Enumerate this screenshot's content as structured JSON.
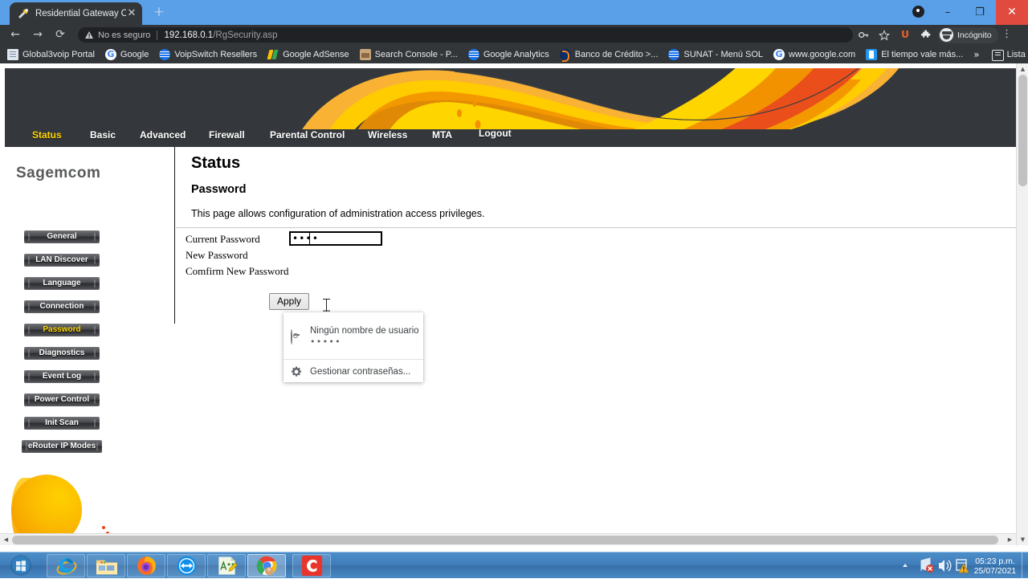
{
  "browser": {
    "tab": {
      "title": "Residential Gateway Configuratio",
      "favicon": "tools-icon",
      "close_label": "✕"
    },
    "new_tab_label": "+",
    "window_controls": {
      "location_icon": "location-pin-icon",
      "minimize": "–",
      "maximize": "❐",
      "close": "✕"
    },
    "toolbar": {
      "back": "←",
      "forward": "→",
      "reload": "⟳",
      "security_label": "No es seguro",
      "url_host": "192.168.0.1",
      "url_path": "/RgSecurity.asp",
      "key_icon": "key-icon",
      "star_icon": "star-icon",
      "extension_u": "U",
      "puzzle_icon": "puzzle-icon",
      "incognito_label": "Incógnito",
      "menu_icon": "⋮"
    },
    "bookmarks": [
      {
        "label": "Global3voip Portal",
        "icon": "document-icon"
      },
      {
        "label": "Google",
        "icon": "google-icon"
      },
      {
        "label": "VoipSwitch Resellers",
        "icon": "globe-icon"
      },
      {
        "label": "Google AdSense",
        "icon": "adsense-icon"
      },
      {
        "label": "Search Console - P...",
        "icon": "search-console-icon"
      },
      {
        "label": "Google Analytics",
        "icon": "globe-icon"
      },
      {
        "label": "Banco de Crédito >...",
        "icon": "bcp-icon"
      },
      {
        "label": "SUNAT - Menú SOL",
        "icon": "globe-icon"
      },
      {
        "label": "www.google.com",
        "icon": "google-icon"
      },
      {
        "label": "El tiempo vale más...",
        "icon": "blue-doc-icon"
      }
    ],
    "bookmarks_overflow": "»",
    "reading_list": "Lista de lectura"
  },
  "router": {
    "nav": [
      {
        "label": "Status",
        "active": true
      },
      {
        "label": "Basic",
        "active": false
      },
      {
        "label": "Advanced",
        "active": false
      },
      {
        "label": "Firewall",
        "active": false
      },
      {
        "label": "Parental Control",
        "active": false
      },
      {
        "label": "Wireless",
        "active": false
      },
      {
        "label": "MTA",
        "active": false
      },
      {
        "label": "Logout",
        "active": false
      }
    ],
    "brand": "Sagemcom",
    "sidebar": [
      {
        "label": "General",
        "active": false
      },
      {
        "label": "LAN Discover",
        "active": false
      },
      {
        "label": "Language",
        "active": false
      },
      {
        "label": "Connection",
        "active": false
      },
      {
        "label": "Password",
        "active": true
      },
      {
        "label": "Diagnostics",
        "active": false
      },
      {
        "label": "Event Log",
        "active": false
      },
      {
        "label": "Power Control",
        "active": false
      },
      {
        "label": "Init Scan",
        "active": false
      },
      {
        "label": "eRouter IP Modes",
        "active": false
      }
    ],
    "page_title": "Status",
    "section_title": "Password",
    "description": "This page allows configuration of administration access privileges.",
    "fields": [
      {
        "label": "Current Password",
        "value": "••••"
      },
      {
        "label": "New Password",
        "value": ""
      },
      {
        "label": "Comfirm New Password",
        "value": ""
      }
    ],
    "apply_label": "Apply"
  },
  "password_dropdown": {
    "username": "Ningún nombre de usuario",
    "masked_password": "•••••",
    "manage_label": "Gestionar contraseñas...",
    "key_icon": "key-circle-icon",
    "gear_icon": "gear-icon"
  },
  "taskbar": {
    "start": "start-orb",
    "items": [
      {
        "name": "internet-explorer",
        "active": false
      },
      {
        "name": "file-explorer",
        "active": false
      },
      {
        "name": "firefox",
        "active": false
      },
      {
        "name": "teamviewer",
        "active": false
      },
      {
        "name": "notepad-plus-plus",
        "active": false
      },
      {
        "name": "google-chrome",
        "active": true
      },
      {
        "name": "camtasia",
        "active": false
      }
    ],
    "tray": {
      "overflow": "▲",
      "network_icon": "network-error-icon",
      "volume_icon": "volume-icon",
      "action_center_icon": "action-center-warning-icon"
    },
    "time": "05:23 p.m.",
    "date": "25/07/2021"
  },
  "colors": {
    "chrome_dark": "#323639",
    "tab_blue": "#5aa0e8",
    "router_banner": "#34373c",
    "accent_yellow": "#ffd500",
    "accent_orange": "#f39200",
    "taskbar_blue": "#3f7dba"
  }
}
